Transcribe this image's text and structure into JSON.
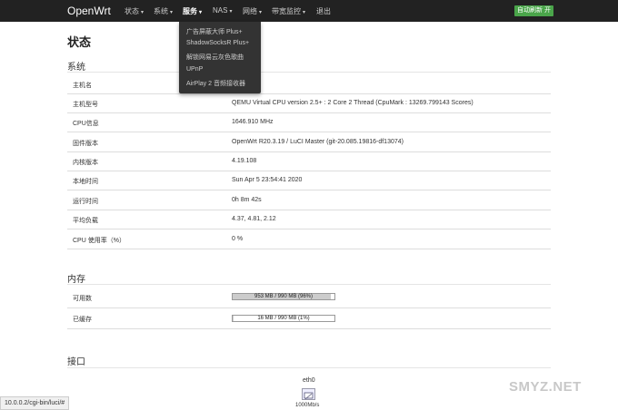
{
  "brand": "OpenWrt",
  "nav": {
    "items": [
      {
        "label": "状态",
        "caret": "▾"
      },
      {
        "label": "系统",
        "caret": "▾"
      },
      {
        "label": "服务",
        "caret": "▾"
      },
      {
        "label": "NAS",
        "caret": "▾"
      },
      {
        "label": "网络",
        "caret": "▾"
      },
      {
        "label": "带宽监控",
        "caret": "▾"
      },
      {
        "label": "退出",
        "caret": ""
      }
    ],
    "refresh_badge": "自动刷新 开"
  },
  "dropdown": {
    "items": [
      "广告屏蔽大师 Plus+",
      "ShadowSocksR Plus+",
      "解锁网易云灰色歌曲",
      "UPnP",
      "AirPlay 2 音频接收器"
    ]
  },
  "page_title": "状态",
  "system": {
    "title": "系统",
    "rows": [
      {
        "label": "主机名",
        "value": ""
      },
      {
        "label": "主机型号",
        "value": "QEMU Virtual CPU version 2.5+ : 2 Core 2 Thread (CpuMark : 13269.799143 Scores)"
      },
      {
        "label": "CPU信息",
        "value": "1646.910 MHz"
      },
      {
        "label": "固件版本",
        "value": "OpenWrt R20.3.19 / LuCI Master (git-20.085.19816-df13074)"
      },
      {
        "label": "内核版本",
        "value": "4.19.108"
      },
      {
        "label": "本地时间",
        "value": "Sun Apr 5 23:54:41 2020"
      },
      {
        "label": "运行时间",
        "value": "0h 8m 42s"
      },
      {
        "label": "平均负载",
        "value": "4.37, 4.81, 2.12"
      },
      {
        "label": "CPU 使用率（%）",
        "value": "0 %"
      }
    ]
  },
  "memory": {
    "title": "内存",
    "rows": [
      {
        "label": "可用数",
        "bar_text": "953 MB / 990 MB (96%)",
        "fill": 0.96
      },
      {
        "label": "已缓存",
        "bar_text": "16 MB / 990 MB (1%)",
        "fill": 0.01
      }
    ]
  },
  "interfaces": {
    "title": "接口",
    "iface_name": "eth0",
    "iface_speed": "1000Mb/s"
  },
  "status_url": "10.0.0.2/cgi-bin/luci/#",
  "watermark": "SMYZ.NET"
}
